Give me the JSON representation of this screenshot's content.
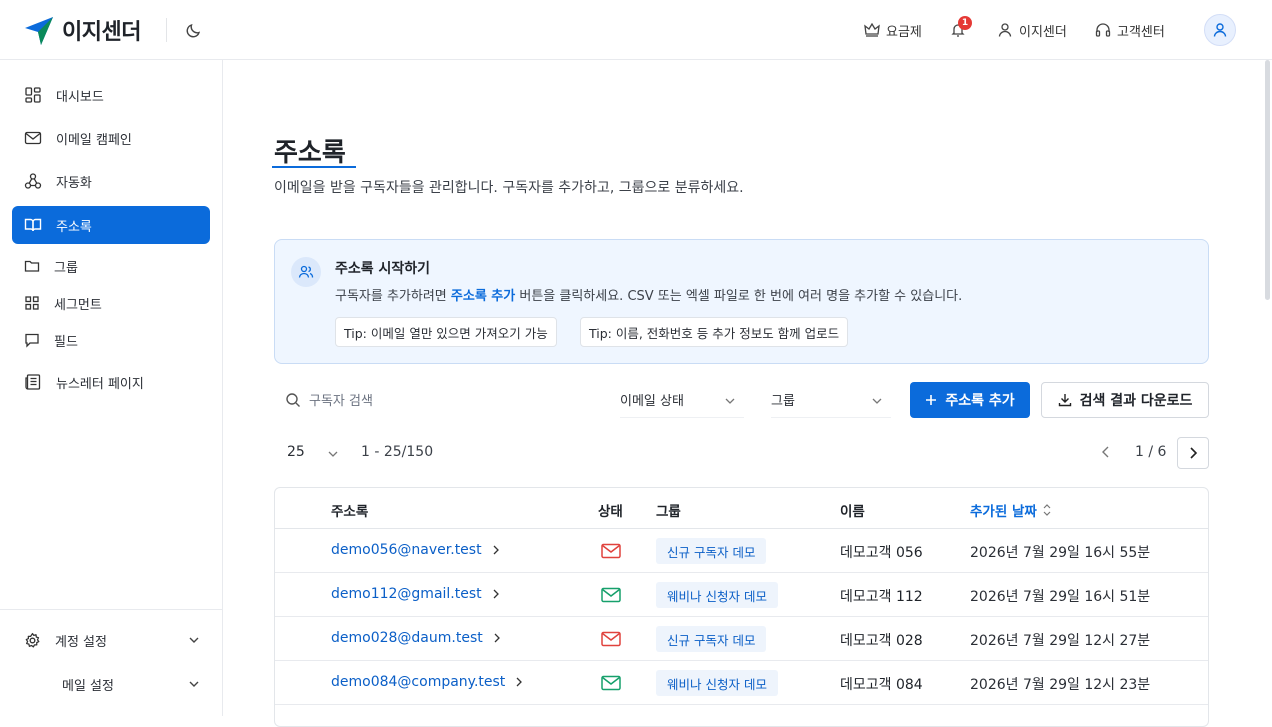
{
  "brand": {
    "name": "이지센더",
    "color": "#0b6bdb"
  },
  "header": {
    "pricing": "요금제",
    "notification_count": "1",
    "account": "이지센더",
    "support": "고객센터"
  },
  "sidebar": {
    "items": [
      {
        "label": "대시보드",
        "icon": "dashboard-icon"
      },
      {
        "label": "이메일 캠페인",
        "icon": "mail-icon"
      },
      {
        "label": "자동화",
        "icon": "automation-icon"
      },
      {
        "label": "주소록",
        "icon": "book-icon",
        "active": true
      },
      {
        "label": "뉴스레터 페이지",
        "icon": "newspaper-icon"
      }
    ],
    "subitems": [
      {
        "label": "그룹",
        "icon": "folder-icon"
      },
      {
        "label": "세그먼트",
        "icon": "grid-icon"
      },
      {
        "label": "필드",
        "icon": "comment-icon"
      }
    ],
    "footer": {
      "account_settings": "계정 설정",
      "email_settings": "메일 설정"
    }
  },
  "page": {
    "title": "주소록",
    "description": "이메일을 받을 구독자들을 관리합니다. 구독자를 추가하고, 그룹으로 분류하세요."
  },
  "info": {
    "title": "주소록 시작하기",
    "text_before": "구독자를 추가하려면 ",
    "text_highlight": "주소록 추가",
    "text_after": " 버튼을 클릭하세요. CSV 또는 엑셀 파일로 한 번에 여러 명을 추가할 수 있습니다.",
    "tips": [
      "Tip: 이메일 열만 있으면 가져오기 가능",
      "Tip: 이름, 전화번호 등 추가 정보도 함께 업로드"
    ]
  },
  "toolbar": {
    "search_placeholder": "구독자 검색",
    "status_filter": "이메일 상태",
    "group_filter": "그룹",
    "add_button": "주소록 추가",
    "download_button": "검색 결과 다운로드"
  },
  "pagination": {
    "page_size": "25",
    "range": "1 - 25/150",
    "page_info": "1 / 6"
  },
  "table": {
    "headers": {
      "email": "주소록",
      "status": "상태",
      "group": "그룹",
      "name": "이름",
      "date": "추가된 날짜"
    },
    "rows": [
      {
        "email": "demo056@naver.test",
        "status": "unopened",
        "status_color": "#e0423d",
        "group": "신규 구독자 데모",
        "name": "데모고객 056",
        "date": "2026년 7월 29일 16시 55분"
      },
      {
        "email": "demo112@gmail.test",
        "status": "opened",
        "status_color": "#16a06b",
        "group": "웨비나 신청자 데모",
        "name": "데모고객 112",
        "date": "2026년 7월 29일 16시 51분"
      },
      {
        "email": "demo028@daum.test",
        "status": "unopened",
        "status_color": "#e0423d",
        "group": "신규 구독자 데모",
        "name": "데모고객 028",
        "date": "2026년 7월 29일 12시 27분"
      },
      {
        "email": "demo084@company.test",
        "status": "opened",
        "status_color": "#16a06b",
        "group": "웨비나 신청자 데모",
        "name": "데모고객 084",
        "date": "2026년 7월 29일 12시 23분"
      }
    ]
  }
}
